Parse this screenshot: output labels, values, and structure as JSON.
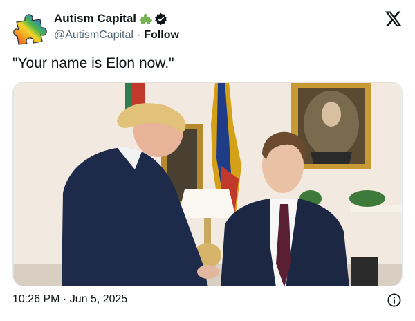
{
  "author": {
    "display_name": "Autism Capital",
    "handle": "@AutismCapital",
    "separator": "·",
    "follow_label": "Follow",
    "avatar_icon": "rainbow-puzzle-piece",
    "badge_emoji": "puzzle-piece-emoji",
    "verified": true
  },
  "header": {
    "platform_icon": "x-logo-icon"
  },
  "tweet": {
    "text": "\"Your name is Elon now.\"",
    "timestamp": "10:26 PM · Jun 5, 2025"
  },
  "media": {
    "kind": "photo",
    "description_icon": "photo-two-men-oval-office"
  },
  "colors": {
    "text": "#0f1419",
    "secondary": "#536471",
    "accent_green": "#77b255"
  }
}
